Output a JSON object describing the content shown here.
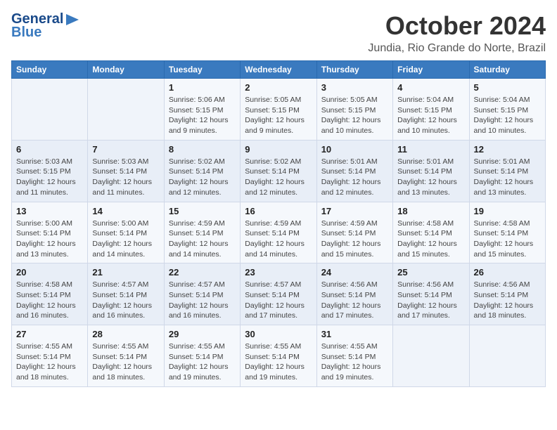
{
  "header": {
    "logo_line1": "General",
    "logo_line2": "Blue",
    "month": "October 2024",
    "location": "Jundia, Rio Grande do Norte, Brazil"
  },
  "weekdays": [
    "Sunday",
    "Monday",
    "Tuesday",
    "Wednesday",
    "Thursday",
    "Friday",
    "Saturday"
  ],
  "weeks": [
    [
      {
        "day": "",
        "info": ""
      },
      {
        "day": "",
        "info": ""
      },
      {
        "day": "1",
        "sunrise": "Sunrise: 5:06 AM",
        "sunset": "Sunset: 5:15 PM",
        "daylight": "Daylight: 12 hours and 9 minutes."
      },
      {
        "day": "2",
        "sunrise": "Sunrise: 5:05 AM",
        "sunset": "Sunset: 5:15 PM",
        "daylight": "Daylight: 12 hours and 9 minutes."
      },
      {
        "day": "3",
        "sunrise": "Sunrise: 5:05 AM",
        "sunset": "Sunset: 5:15 PM",
        "daylight": "Daylight: 12 hours and 10 minutes."
      },
      {
        "day": "4",
        "sunrise": "Sunrise: 5:04 AM",
        "sunset": "Sunset: 5:15 PM",
        "daylight": "Daylight: 12 hours and 10 minutes."
      },
      {
        "day": "5",
        "sunrise": "Sunrise: 5:04 AM",
        "sunset": "Sunset: 5:15 PM",
        "daylight": "Daylight: 12 hours and 10 minutes."
      }
    ],
    [
      {
        "day": "6",
        "sunrise": "Sunrise: 5:03 AM",
        "sunset": "Sunset: 5:15 PM",
        "daylight": "Daylight: 12 hours and 11 minutes."
      },
      {
        "day": "7",
        "sunrise": "Sunrise: 5:03 AM",
        "sunset": "Sunset: 5:14 PM",
        "daylight": "Daylight: 12 hours and 11 minutes."
      },
      {
        "day": "8",
        "sunrise": "Sunrise: 5:02 AM",
        "sunset": "Sunset: 5:14 PM",
        "daylight": "Daylight: 12 hours and 12 minutes."
      },
      {
        "day": "9",
        "sunrise": "Sunrise: 5:02 AM",
        "sunset": "Sunset: 5:14 PM",
        "daylight": "Daylight: 12 hours and 12 minutes."
      },
      {
        "day": "10",
        "sunrise": "Sunrise: 5:01 AM",
        "sunset": "Sunset: 5:14 PM",
        "daylight": "Daylight: 12 hours and 12 minutes."
      },
      {
        "day": "11",
        "sunrise": "Sunrise: 5:01 AM",
        "sunset": "Sunset: 5:14 PM",
        "daylight": "Daylight: 12 hours and 13 minutes."
      },
      {
        "day": "12",
        "sunrise": "Sunrise: 5:01 AM",
        "sunset": "Sunset: 5:14 PM",
        "daylight": "Daylight: 12 hours and 13 minutes."
      }
    ],
    [
      {
        "day": "13",
        "sunrise": "Sunrise: 5:00 AM",
        "sunset": "Sunset: 5:14 PM",
        "daylight": "Daylight: 12 hours and 13 minutes."
      },
      {
        "day": "14",
        "sunrise": "Sunrise: 5:00 AM",
        "sunset": "Sunset: 5:14 PM",
        "daylight": "Daylight: 12 hours and 14 minutes."
      },
      {
        "day": "15",
        "sunrise": "Sunrise: 4:59 AM",
        "sunset": "Sunset: 5:14 PM",
        "daylight": "Daylight: 12 hours and 14 minutes."
      },
      {
        "day": "16",
        "sunrise": "Sunrise: 4:59 AM",
        "sunset": "Sunset: 5:14 PM",
        "daylight": "Daylight: 12 hours and 14 minutes."
      },
      {
        "day": "17",
        "sunrise": "Sunrise: 4:59 AM",
        "sunset": "Sunset: 5:14 PM",
        "daylight": "Daylight: 12 hours and 15 minutes."
      },
      {
        "day": "18",
        "sunrise": "Sunrise: 4:58 AM",
        "sunset": "Sunset: 5:14 PM",
        "daylight": "Daylight: 12 hours and 15 minutes."
      },
      {
        "day": "19",
        "sunrise": "Sunrise: 4:58 AM",
        "sunset": "Sunset: 5:14 PM",
        "daylight": "Daylight: 12 hours and 15 minutes."
      }
    ],
    [
      {
        "day": "20",
        "sunrise": "Sunrise: 4:58 AM",
        "sunset": "Sunset: 5:14 PM",
        "daylight": "Daylight: 12 hours and 16 minutes."
      },
      {
        "day": "21",
        "sunrise": "Sunrise: 4:57 AM",
        "sunset": "Sunset: 5:14 PM",
        "daylight": "Daylight: 12 hours and 16 minutes."
      },
      {
        "day": "22",
        "sunrise": "Sunrise: 4:57 AM",
        "sunset": "Sunset: 5:14 PM",
        "daylight": "Daylight: 12 hours and 16 minutes."
      },
      {
        "day": "23",
        "sunrise": "Sunrise: 4:57 AM",
        "sunset": "Sunset: 5:14 PM",
        "daylight": "Daylight: 12 hours and 17 minutes."
      },
      {
        "day": "24",
        "sunrise": "Sunrise: 4:56 AM",
        "sunset": "Sunset: 5:14 PM",
        "daylight": "Daylight: 12 hours and 17 minutes."
      },
      {
        "day": "25",
        "sunrise": "Sunrise: 4:56 AM",
        "sunset": "Sunset: 5:14 PM",
        "daylight": "Daylight: 12 hours and 17 minutes."
      },
      {
        "day": "26",
        "sunrise": "Sunrise: 4:56 AM",
        "sunset": "Sunset: 5:14 PM",
        "daylight": "Daylight: 12 hours and 18 minutes."
      }
    ],
    [
      {
        "day": "27",
        "sunrise": "Sunrise: 4:55 AM",
        "sunset": "Sunset: 5:14 PM",
        "daylight": "Daylight: 12 hours and 18 minutes."
      },
      {
        "day": "28",
        "sunrise": "Sunrise: 4:55 AM",
        "sunset": "Sunset: 5:14 PM",
        "daylight": "Daylight: 12 hours and 18 minutes."
      },
      {
        "day": "29",
        "sunrise": "Sunrise: 4:55 AM",
        "sunset": "Sunset: 5:14 PM",
        "daylight": "Daylight: 12 hours and 19 minutes."
      },
      {
        "day": "30",
        "sunrise": "Sunrise: 4:55 AM",
        "sunset": "Sunset: 5:14 PM",
        "daylight": "Daylight: 12 hours and 19 minutes."
      },
      {
        "day": "31",
        "sunrise": "Sunrise: 4:55 AM",
        "sunset": "Sunset: 5:14 PM",
        "daylight": "Daylight: 12 hours and 19 minutes."
      },
      {
        "day": "",
        "info": ""
      },
      {
        "day": "",
        "info": ""
      }
    ]
  ]
}
